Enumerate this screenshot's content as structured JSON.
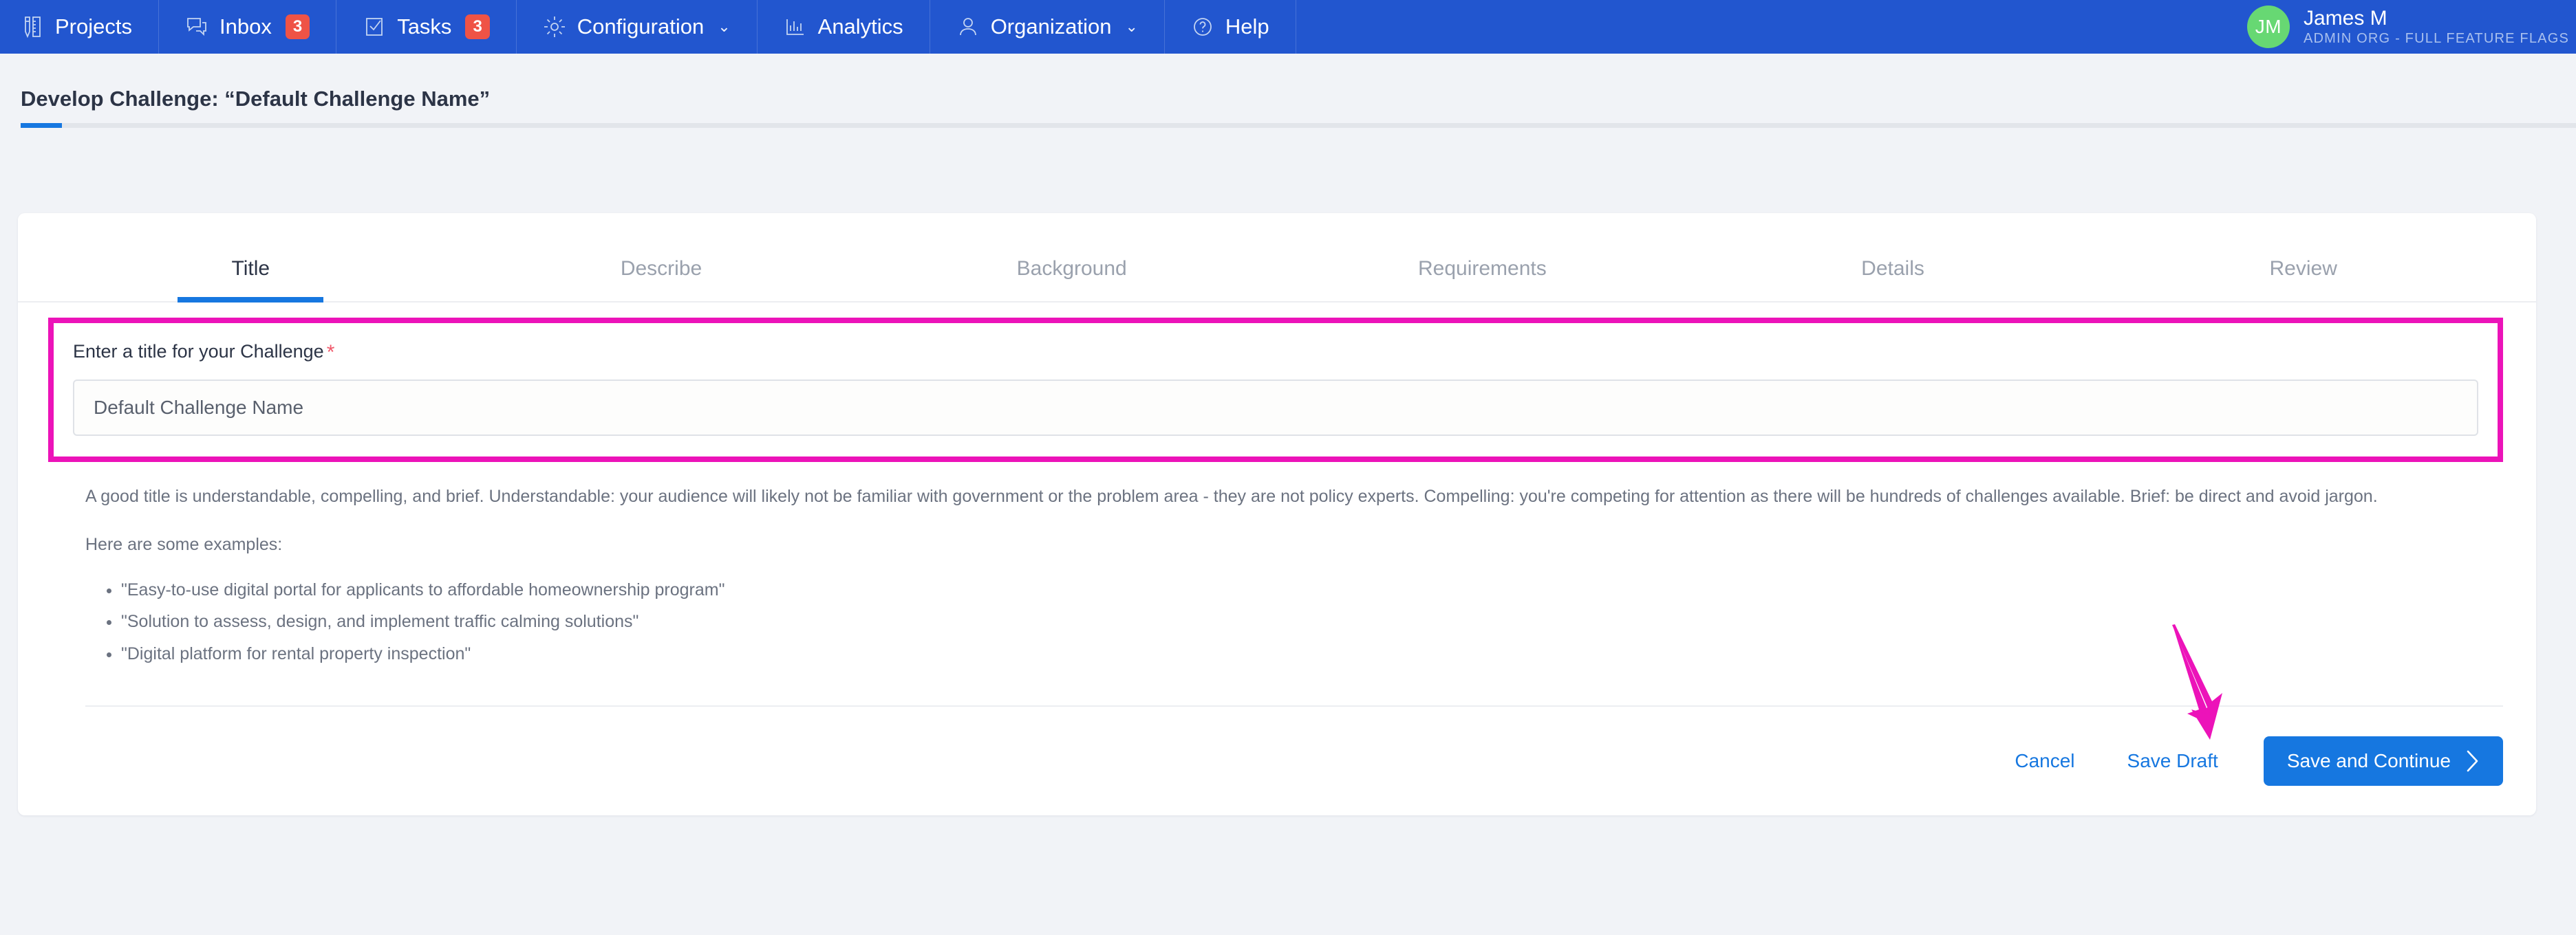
{
  "nav": {
    "items": [
      {
        "label": "Projects",
        "icon": "ruler-pencil-icon",
        "badge": null,
        "caret": false
      },
      {
        "label": "Inbox",
        "icon": "chat-bubble-icon",
        "badge": "3",
        "caret": false
      },
      {
        "label": "Tasks",
        "icon": "checklist-icon",
        "badge": "3",
        "caret": false
      },
      {
        "label": "Configuration",
        "icon": "gear-icon",
        "badge": null,
        "caret": true
      },
      {
        "label": "Analytics",
        "icon": "bar-chart-icon",
        "badge": null,
        "caret": false
      },
      {
        "label": "Organization",
        "icon": "user-icon",
        "badge": null,
        "caret": true
      },
      {
        "label": "Help",
        "icon": "question-circle-icon",
        "badge": null,
        "caret": false
      }
    ],
    "profile": {
      "initials": "JM",
      "name": "James M",
      "org": "ADMIN ORG - FULL FEATURE FLAGS"
    }
  },
  "header": {
    "title": "Develop Challenge: “Default Challenge Name”"
  },
  "tabs": [
    {
      "label": "Title",
      "active": true
    },
    {
      "label": "Describe",
      "active": false
    },
    {
      "label": "Background",
      "active": false
    },
    {
      "label": "Requirements",
      "active": false
    },
    {
      "label": "Details",
      "active": false
    },
    {
      "label": "Review",
      "active": false
    }
  ],
  "form": {
    "label": "Enter a title for your Challenge",
    "required_marker": "*",
    "input_value": "Default Challenge Name",
    "input_placeholder": "Default Challenge Name"
  },
  "help": {
    "paragraph": "A good title is understandable, compelling, and brief. Understandable: your audience will likely not be familiar with government or the problem area - they are not policy experts. Compelling: you're competing for attention as there will be hundreds of challenges available. Brief: be direct and avoid jargon.",
    "examples_intro": "Here are some examples:",
    "examples": [
      "\"Easy-to-use digital portal for applicants to affordable homeownership program\"",
      "\"Solution to assess, design, and implement traffic calming solutions\"",
      "\"Digital platform for rental property inspection\""
    ]
  },
  "footer": {
    "cancel_label": "Cancel",
    "save_draft_label": "Save Draft",
    "save_continue_label": "Save and Continue"
  },
  "colors": {
    "nav_blue": "#2256cf",
    "accent_blue": "#1677e0",
    "badge_red": "#ef5346",
    "avatar_green": "#67d873",
    "annotation_magenta": "#ec13b9",
    "required_red": "#f0596b"
  }
}
